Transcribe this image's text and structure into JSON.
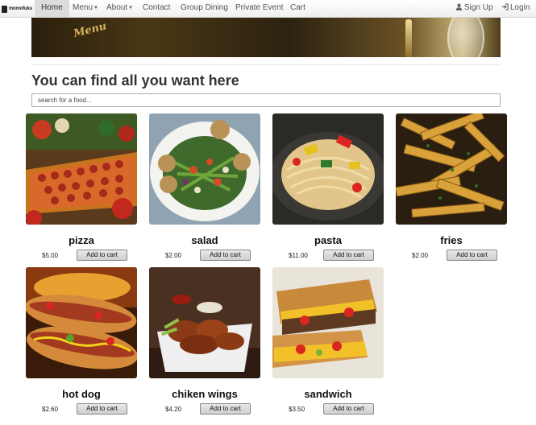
{
  "nav": {
    "brand": "momofuku",
    "items": [
      {
        "label": "Home",
        "active": true
      },
      {
        "label": "Menu",
        "dropdown": true
      },
      {
        "label": "About",
        "dropdown": true
      },
      {
        "label": "Contact"
      },
      {
        "label": "Group Dining"
      },
      {
        "label": "Private Event"
      },
      {
        "label": "Cart"
      }
    ],
    "signup": "Sign Up",
    "login": "Login"
  },
  "banner": {
    "script_text": "Menu"
  },
  "page": {
    "heading": "You can find all you want here",
    "search_placeholder": "search for a food..."
  },
  "add_label": "Add to cart",
  "foods": [
    {
      "name": "pizza",
      "price": "$5.00"
    },
    {
      "name": "salad",
      "price": "$2.00"
    },
    {
      "name": "pasta",
      "price": "$11.00"
    },
    {
      "name": "fries",
      "price": "$2.00"
    },
    {
      "name": "hot dog",
      "price": "$2.60"
    },
    {
      "name": "chiken wings",
      "price": "$4.20"
    },
    {
      "name": "sandwich",
      "price": "$3.50"
    }
  ]
}
